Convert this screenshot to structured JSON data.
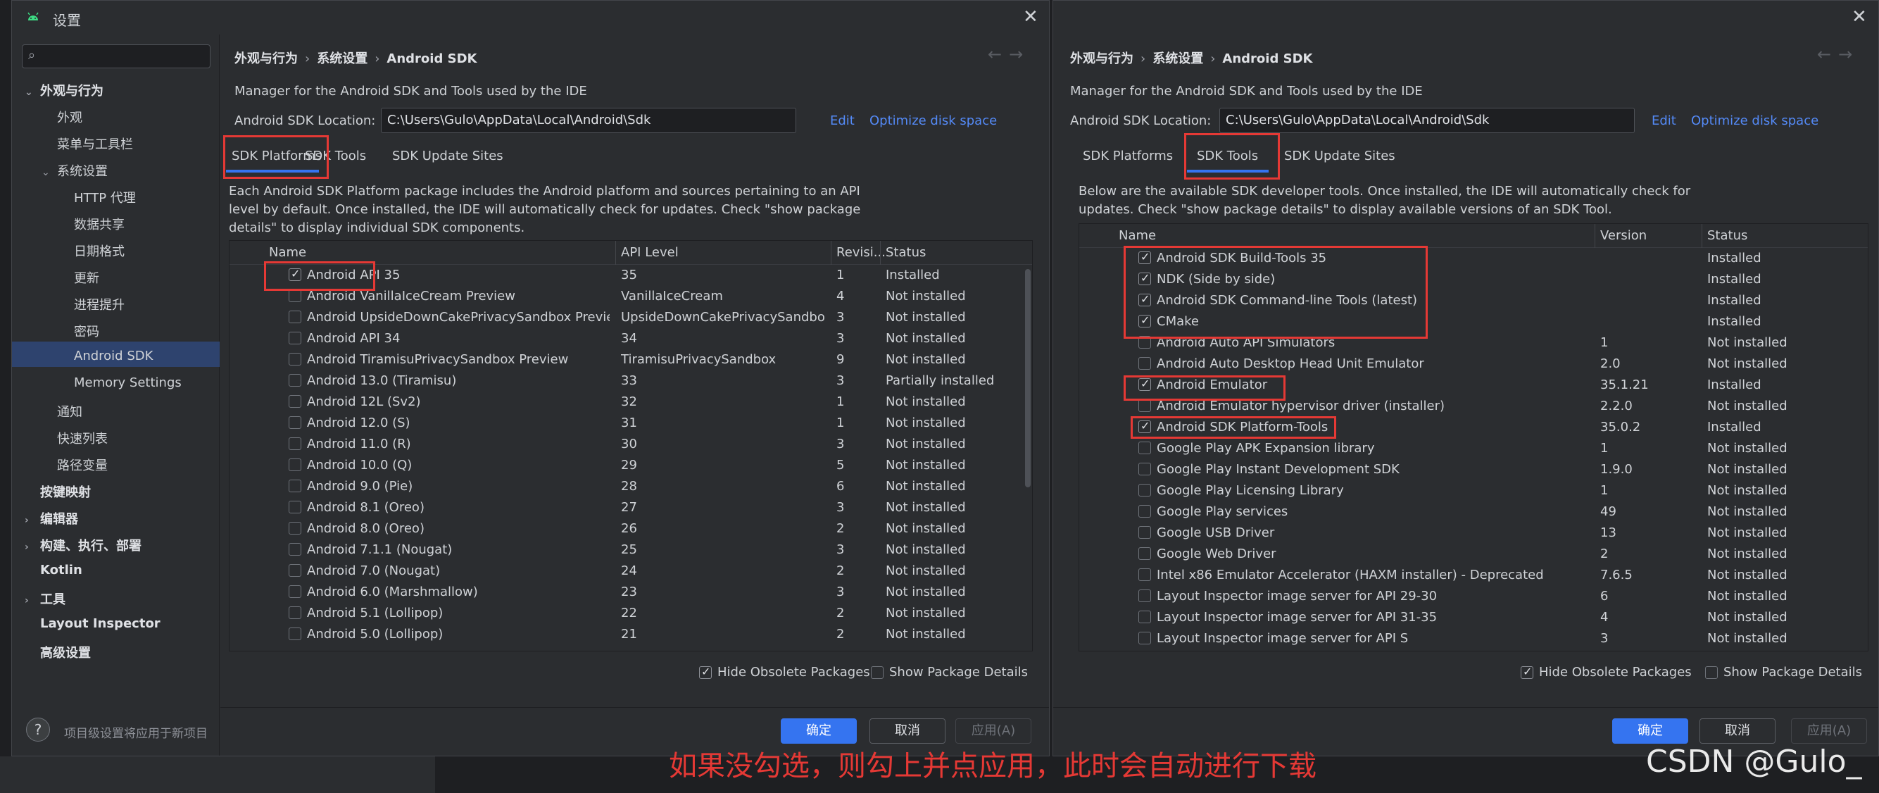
{
  "colors": {
    "accent": "#3574f0",
    "link": "#548af7",
    "highlight_box": "#e53935",
    "bg": "#2b2d30"
  },
  "icons": {
    "app": "android-icon",
    "close": "close-icon",
    "search": "search-icon",
    "help": "help-icon"
  },
  "left": {
    "title": "设置",
    "search_placeholder": "",
    "sidebar": {
      "items": [
        {
          "label": "外观与行为",
          "expanded": true
        },
        {
          "label": "外观"
        },
        {
          "label": "菜单与工具栏"
        },
        {
          "label": "系统设置",
          "expanded": true
        },
        {
          "label": "HTTP 代理"
        },
        {
          "label": "数据共享"
        },
        {
          "label": "日期格式"
        },
        {
          "label": "更新"
        },
        {
          "label": "进程提升"
        },
        {
          "label": "密码"
        },
        {
          "label": "Android SDK",
          "selected": true
        },
        {
          "label": "Memory Settings"
        },
        {
          "label": "通知"
        },
        {
          "label": "快速列表"
        },
        {
          "label": "路径变量"
        },
        {
          "label": "按键映射"
        },
        {
          "label": "编辑器"
        },
        {
          "label": "构建、执行、部署"
        },
        {
          "label": "Kotlin"
        },
        {
          "label": "工具"
        },
        {
          "label": "Layout Inspector"
        },
        {
          "label": "高级设置"
        }
      ],
      "footer": "项目级设置将应用于新项目"
    },
    "breadcrumb": [
      "外观与行为",
      "系统设置",
      "Android SDK"
    ],
    "description": "Manager for the Android SDK and Tools used by the IDE",
    "location_label": "Android SDK Location:",
    "location_value": "C:\\Users\\Gulo\\AppData\\Local\\Android\\Sdk",
    "edit_link": "Edit",
    "optimize_link": "Optimize disk space",
    "tabs": [
      "SDK Platforms",
      "SDK Tools",
      "SDK Update Sites"
    ],
    "active_tab": "SDK Platforms",
    "note": [
      "Each Android SDK Platform package includes the Android platform and sources pertaining to an API",
      "level by default. Once installed, the IDE will automatically check for updates. Check \"show package",
      "details\" to display individual SDK components."
    ],
    "columns": [
      "Name",
      "API Level",
      "Revisi...",
      "Status"
    ],
    "rows": [
      {
        "checked": true,
        "name": "Android API 35",
        "api": "35",
        "rev": "1",
        "status": "Installed"
      },
      {
        "checked": false,
        "name": "Android VanillaIceCream Preview",
        "api": "VanillaIceCream",
        "rev": "4",
        "status": "Not installed"
      },
      {
        "checked": false,
        "name": "Android UpsideDownCakePrivacySandbox Preview",
        "api": "UpsideDownCakePrivacySandbox",
        "rev": "3",
        "status": "Not installed"
      },
      {
        "checked": false,
        "name": "Android API 34",
        "api": "34",
        "rev": "3",
        "status": "Not installed"
      },
      {
        "checked": false,
        "name": "Android TiramisuPrivacySandbox Preview",
        "api": "TiramisuPrivacySandbox",
        "rev": "9",
        "status": "Not installed"
      },
      {
        "checked": false,
        "name": "Android 13.0 (Tiramisu)",
        "api": "33",
        "rev": "3",
        "status": "Partially installed"
      },
      {
        "checked": false,
        "name": "Android 12L (Sv2)",
        "api": "32",
        "rev": "1",
        "status": "Not installed"
      },
      {
        "checked": false,
        "name": "Android 12.0 (S)",
        "api": "31",
        "rev": "1",
        "status": "Not installed"
      },
      {
        "checked": false,
        "name": "Android 11.0 (R)",
        "api": "30",
        "rev": "3",
        "status": "Not installed"
      },
      {
        "checked": false,
        "name": "Android 10.0 (Q)",
        "api": "29",
        "rev": "5",
        "status": "Not installed"
      },
      {
        "checked": false,
        "name": "Android 9.0 (Pie)",
        "api": "28",
        "rev": "6",
        "status": "Not installed"
      },
      {
        "checked": false,
        "name": "Android 8.1 (Oreo)",
        "api": "27",
        "rev": "3",
        "status": "Not installed"
      },
      {
        "checked": false,
        "name": "Android 8.0 (Oreo)",
        "api": "26",
        "rev": "2",
        "status": "Not installed"
      },
      {
        "checked": false,
        "name": "Android 7.1.1 (Nougat)",
        "api": "25",
        "rev": "3",
        "status": "Not installed"
      },
      {
        "checked": false,
        "name": "Android 7.0 (Nougat)",
        "api": "24",
        "rev": "2",
        "status": "Not installed"
      },
      {
        "checked": false,
        "name": "Android 6.0 (Marshmallow)",
        "api": "23",
        "rev": "3",
        "status": "Not installed"
      },
      {
        "checked": false,
        "name": "Android 5.1 (Lollipop)",
        "api": "22",
        "rev": "2",
        "status": "Not installed"
      },
      {
        "checked": false,
        "name": "Android 5.0 (Lollipop)",
        "api": "21",
        "rev": "2",
        "status": "Not installed"
      }
    ],
    "hide_obsolete_label": "Hide Obsolete Packages",
    "hide_obsolete_checked": true,
    "show_details_label": "Show Package Details",
    "show_details_checked": false,
    "ok_label": "确定",
    "cancel_label": "取消",
    "apply_label": "应用(A)"
  },
  "right": {
    "breadcrumb": [
      "外观与行为",
      "系统设置",
      "Android SDK"
    ],
    "description": "Manager for the Android SDK and Tools used by the IDE",
    "location_label": "Android SDK Location:",
    "location_value": "C:\\Users\\Gulo\\AppData\\Local\\Android\\Sdk",
    "edit_link": "Edit",
    "optimize_link": "Optimize disk space",
    "tabs": [
      "SDK Platforms",
      "SDK Tools",
      "SDK Update Sites"
    ],
    "active_tab": "SDK Tools",
    "note": [
      "Below are the available SDK developer tools. Once installed, the IDE will automatically check for",
      "updates. Check \"show package details\" to display available versions of an SDK Tool."
    ],
    "columns": [
      "Name",
      "Version",
      "Status"
    ],
    "rows": [
      {
        "checked": true,
        "name": "Android SDK Build-Tools 35",
        "version": "",
        "status": "Installed"
      },
      {
        "checked": true,
        "name": "NDK (Side by side)",
        "version": "",
        "status": "Installed"
      },
      {
        "checked": true,
        "name": "Android SDK Command-line Tools (latest)",
        "version": "",
        "status": "Installed"
      },
      {
        "checked": true,
        "name": "CMake",
        "version": "",
        "status": "Installed"
      },
      {
        "checked": false,
        "name": "Android Auto API Simulators",
        "version": "1",
        "status": "Not installed"
      },
      {
        "checked": false,
        "name": "Android Auto Desktop Head Unit Emulator",
        "version": "2.0",
        "status": "Not installed"
      },
      {
        "checked": true,
        "name": "Android Emulator",
        "version": "35.1.21",
        "status": "Installed"
      },
      {
        "checked": false,
        "name": "Android Emulator hypervisor driver (installer)",
        "version": "2.2.0",
        "status": "Not installed"
      },
      {
        "checked": true,
        "name": "Android SDK Platform-Tools",
        "version": "35.0.2",
        "status": "Installed"
      },
      {
        "checked": false,
        "name": "Google Play APK Expansion library",
        "version": "1",
        "status": "Not installed"
      },
      {
        "checked": false,
        "name": "Google Play Instant Development SDK",
        "version": "1.9.0",
        "status": "Not installed"
      },
      {
        "checked": false,
        "name": "Google Play Licensing Library",
        "version": "1",
        "status": "Not installed"
      },
      {
        "checked": false,
        "name": "Google Play services",
        "version": "49",
        "status": "Not installed"
      },
      {
        "checked": false,
        "name": "Google USB Driver",
        "version": "13",
        "status": "Not installed"
      },
      {
        "checked": false,
        "name": "Google Web Driver",
        "version": "2",
        "status": "Not installed"
      },
      {
        "checked": false,
        "name": "Intel x86 Emulator Accelerator (HAXM installer) - Deprecated",
        "version": "7.6.5",
        "status": "Not installed"
      },
      {
        "checked": false,
        "name": "Layout Inspector image server for API 29-30",
        "version": "6",
        "status": "Not installed"
      },
      {
        "checked": false,
        "name": "Layout Inspector image server for API 31-35",
        "version": "4",
        "status": "Not installed"
      },
      {
        "checked": false,
        "name": "Layout Inspector image server for API S",
        "version": "3",
        "status": "Not installed"
      }
    ],
    "hide_obsolete_label": "Hide Obsolete Packages",
    "hide_obsolete_checked": true,
    "show_details_label": "Show Package Details",
    "show_details_checked": false,
    "ok_label": "确定",
    "cancel_label": "取消",
    "apply_label": "应用(A)"
  },
  "caption": "如果没勾选，则勾上并点应用，此时会自动进行下载",
  "watermark": "CSDN @Gulo_"
}
